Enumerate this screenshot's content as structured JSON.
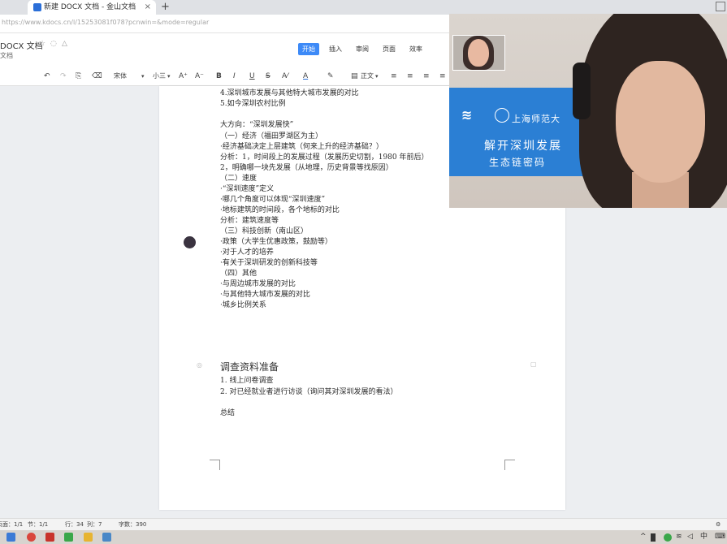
{
  "browser": {
    "tab_title": "新建 DOCX 文档 - 金山文档",
    "tab_close": "×",
    "new_tab": "+",
    "url": "https://www.kdocs.cn/l/15253081f078?pcnwin=&mode=regular"
  },
  "app": {
    "doc_title": "DOCX 文档",
    "doc_subtitle": "文档",
    "menu_tabs": [
      "开始",
      "插入",
      "审阅",
      "页面",
      "效率"
    ],
    "active_tab": "开始"
  },
  "toolbar": {
    "undo": "↶",
    "redo": "↷",
    "format_painter": "⎘",
    "clear_format": "⌫",
    "font_name": "宋体",
    "font_size": "小三",
    "grow_font": "A⁺",
    "shrink_font": "A⁻",
    "bold": "B",
    "italic": "I",
    "underline": "U",
    "strike": "S",
    "font_color": "A",
    "highlight": "✎",
    "style": "正文",
    "style_caret": "▾"
  },
  "document": {
    "lines": [
      "4.深圳城市发展与其他特大城市发展的对比",
      "5.如今深圳农村比例",
      "",
      "大方向：“深圳发展快”",
      "（一）经济（福田罗湖区为主）",
      "·经济基础决定上层建筑（何来上升的经济基础？）",
      "分析：1，时间段上的发展过程（发展历史切割，1980 年前后）",
      "          2，明确哪一块先发展（从地理，历史背景等找原因）",
      "（二）速度",
      "·“深圳速度”定义",
      "·哪几个角度可以体现“深圳速度”",
      "·地标建筑的时间段，各个地标的对比",
      "分析：建筑速度等",
      "（三）科技创新（南山区）",
      "·政策（大学生优惠政策，鼓励等）",
      "·对于人才的培养",
      "·有关于深圳研发的创新科技等",
      "（四）其他",
      "·与周边城市发展的对比",
      "·与其他特大城市发展的对比",
      "·城乡比例关系"
    ],
    "heading": "调查资料准备",
    "list": [
      "1. 线上问卷调查",
      "2. 对已经就业者进行访谈（询问其对深圳发展的看法）"
    ],
    "summary": "总结"
  },
  "statusbar": {
    "page": "页面：1/1",
    "section": "节：1/1",
    "row": "行：34",
    "col": "列：7",
    "words": "字数：390"
  },
  "video": {
    "banner_brand": "上海师范大",
    "banner_line1": "解开深圳发展",
    "banner_line2": "生态链密码"
  },
  "taskbar": {
    "ime": "中",
    "tray_icons": [
      "^",
      "🔋",
      "🔈"
    ]
  },
  "colors": {
    "accent": "#3d8af7",
    "banner": "#2b7fd4"
  }
}
